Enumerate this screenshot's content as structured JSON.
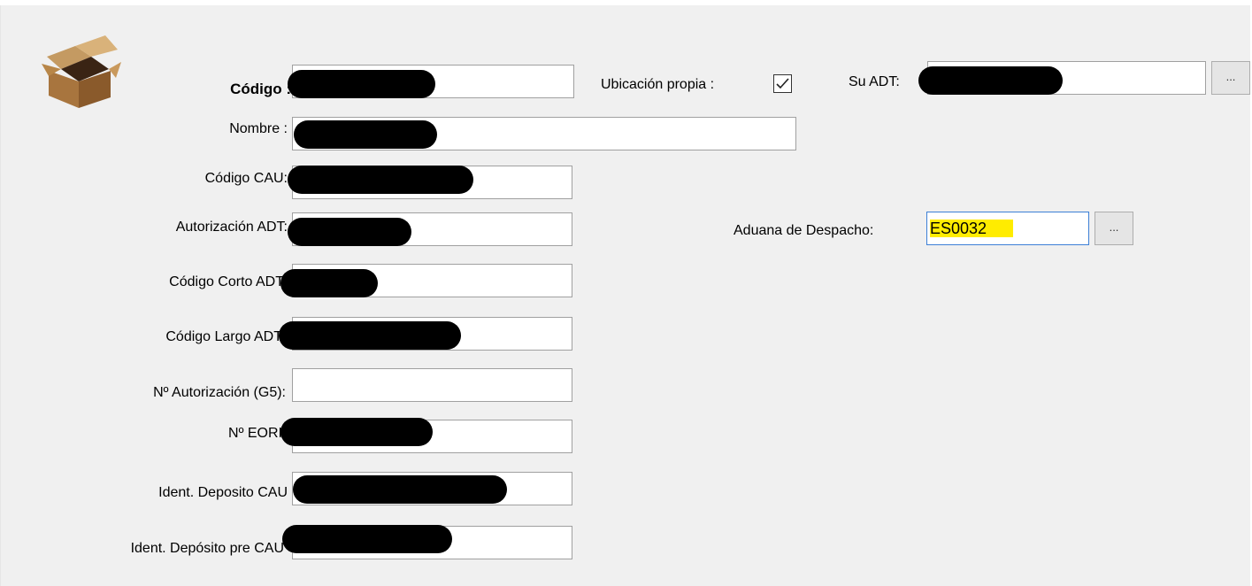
{
  "form": {
    "codigo_label": "Código :",
    "ubicacion_label": "Ubicación propia :",
    "ubicacion_checked": true,
    "su_adt_label": "Su ADT:",
    "su_adt_button": "...",
    "nombre_label": "Nombre :",
    "codigo_cau_label": "Código CAU:",
    "autorizacion_adt_label": "Autorización ADT:",
    "aduana_label": "Aduana de Despacho:",
    "aduana_value": "ES0032",
    "aduana_button": "...",
    "codigo_corto_label": "Código Corto ADT",
    "codigo_largo_label": "Código Largo ADT",
    "n_autorizacion_label": "Nº Autorización (G5):",
    "n_eori_label": "Nº EORI",
    "ident_deposito_cau_label": "Ident. Deposito CAU",
    "ident_deposito_pre_cau_label": "Ident. Depósito pre CAU"
  },
  "icons": {
    "logo": "box-icon",
    "check": "check-icon"
  },
  "colors": {
    "panel": "#f0f0f0",
    "highlight": "#ffec00",
    "focus_border": "#3c7fd6"
  }
}
